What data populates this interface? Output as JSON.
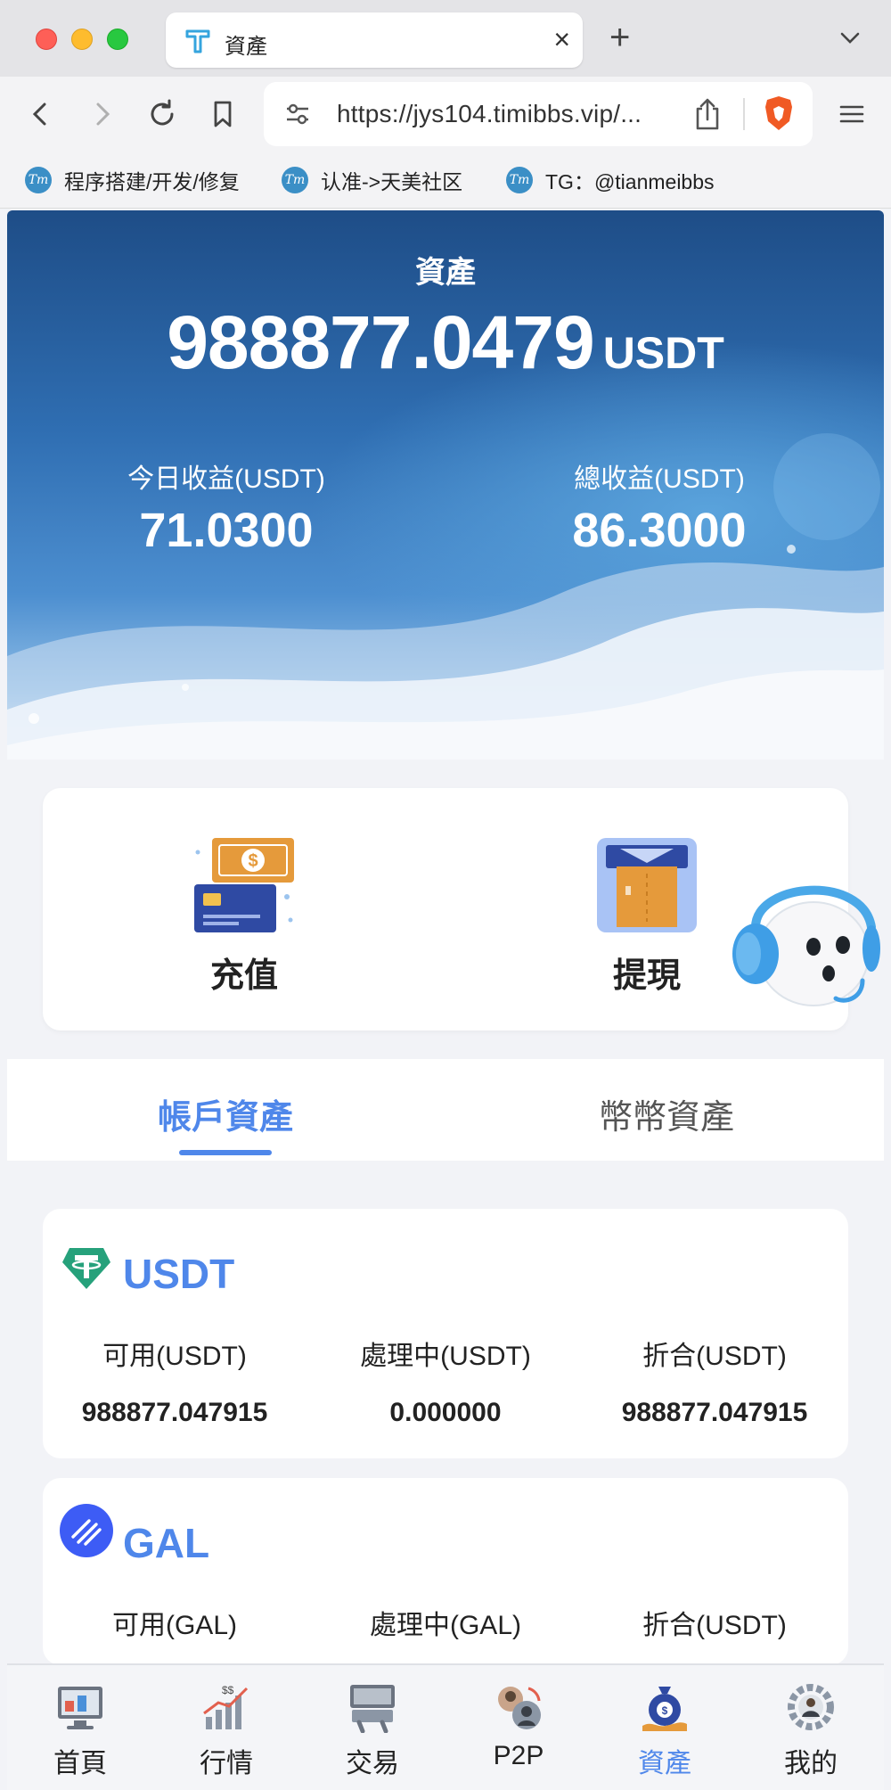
{
  "browser": {
    "tab_title": "資產",
    "url": "https://jys104.timibbs.vip/...",
    "bookmarks": [
      "程序搭建/开发/修复",
      "认准->天美社区",
      "TG：@tianmeibbs"
    ],
    "bookmark_icon_text": "Tm"
  },
  "hero": {
    "title": "資產",
    "amount": "988877.0479",
    "unit": "USDT",
    "today_label": "今日收益(USDT)",
    "today_value": "71.0300",
    "total_label": "總收益(USDT)",
    "total_value": "86.3000"
  },
  "actions": {
    "deposit": "充值",
    "withdraw": "提現"
  },
  "asset_tabs": {
    "account": "帳戶資產",
    "coin": "幣幣資產",
    "active": "account"
  },
  "coins": [
    {
      "name": "USDT",
      "available_label": "可用(USDT)",
      "processing_label": "處理中(USDT)",
      "equivalent_label": "折合(USDT)",
      "available": "988877.047915",
      "processing": "0.000000",
      "equivalent": "988877.047915"
    },
    {
      "name": "GAL",
      "available_label": "可用(GAL)",
      "processing_label": "處理中(GAL)",
      "equivalent_label": "折合(USDT)"
    }
  ],
  "bottom_nav": [
    {
      "label": "首頁",
      "icon": "home-icon"
    },
    {
      "label": "行情",
      "icon": "market-icon"
    },
    {
      "label": "交易",
      "icon": "trade-icon"
    },
    {
      "label": "P2P",
      "icon": "p2p-icon"
    },
    {
      "label": "資產",
      "icon": "assets-icon",
      "active": true
    },
    {
      "label": "我的",
      "icon": "profile-icon"
    }
  ],
  "colors": {
    "accent": "#4f87ea",
    "hero_dark": "#1e4d87",
    "tether_green": "#26a17b",
    "gal_blue": "#3d5cf5"
  }
}
